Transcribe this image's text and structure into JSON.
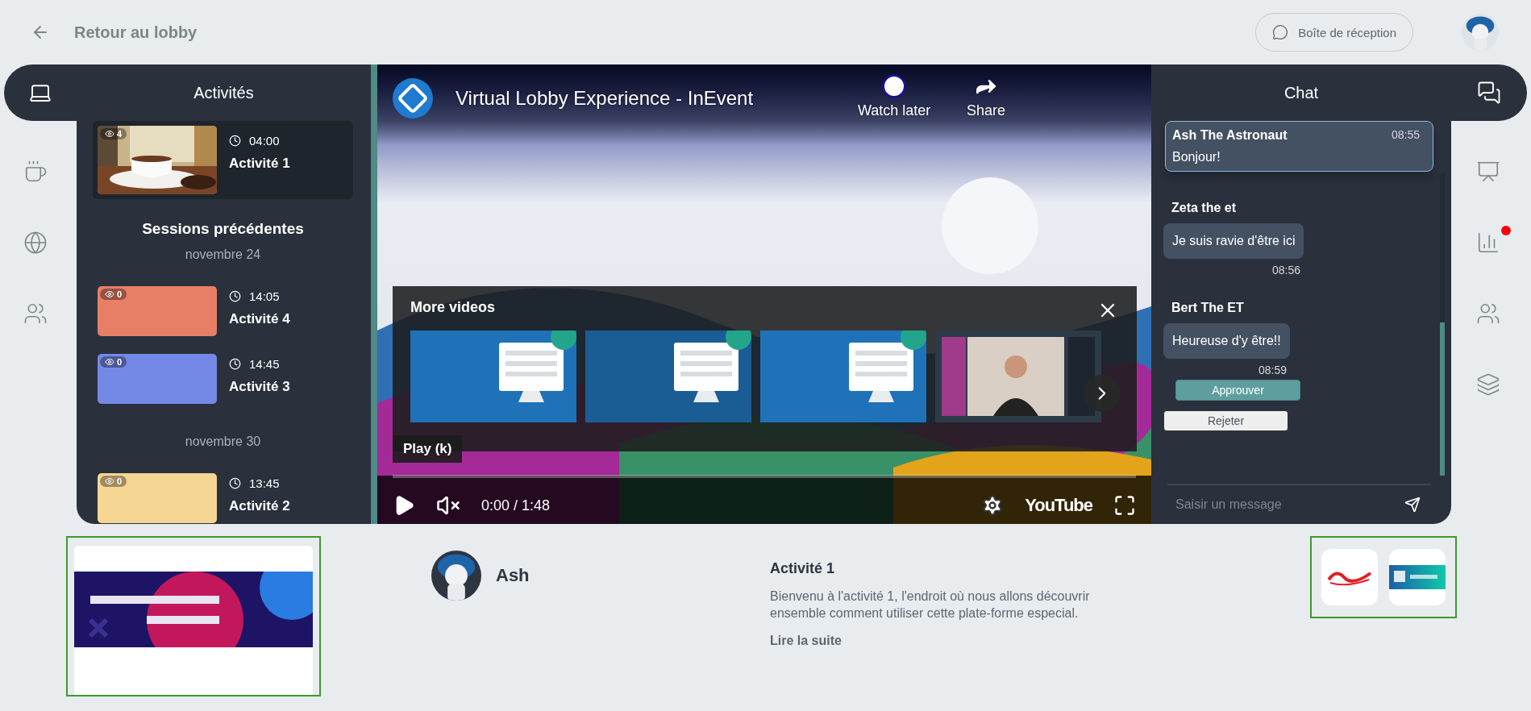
{
  "top_bar": {
    "back_label": "Retour au lobby",
    "inbox_button": "Boîte de réception"
  },
  "left_rail": [
    {
      "kind": "laptop",
      "selected": true
    },
    {
      "kind": "coffee",
      "selected": false
    },
    {
      "kind": "globe",
      "selected": false
    },
    {
      "kind": "people",
      "selected": false
    }
  ],
  "activities": {
    "title": "Activités",
    "current": {
      "views": "4",
      "time": "04:00",
      "name": "Activité 1",
      "kind": "picture",
      "selected": true
    },
    "past_title": "Sessions précédentes",
    "groups": [
      {
        "date": "novembre 24",
        "items": [
          {
            "views": "0",
            "time": "14:05",
            "name": "Activité 4",
            "color": "#e77f67",
            "selected": false
          },
          {
            "views": "0",
            "time": "14:45",
            "name": "Activité 3",
            "color": "#7489e6",
            "selected": false
          }
        ]
      },
      {
        "date": "novembre 30",
        "items": [
          {
            "views": "0",
            "time": "13:45",
            "name": "Activité 2",
            "color": "#f6d693",
            "selected": false
          }
        ]
      }
    ]
  },
  "video": {
    "title": "Virtual Lobby Experience - InEvent",
    "watch_later": "Watch later",
    "share": "Share",
    "more_videos": {
      "title": "More videos"
    },
    "tooltip": "Play (k)",
    "time": "0:00 / 1:48",
    "logo": "YouTube",
    "muted": true
  },
  "chat": {
    "title": "Chat",
    "pinned": {
      "author": "Ash The Astronaut",
      "time": "08:55",
      "text": "Bonjour!"
    },
    "messages": [
      {
        "author": "Zeta the et",
        "text": "Je suis ravie d'être ici",
        "time": "08:56"
      },
      {
        "author": "Bert The ET",
        "text": "Heureuse d'y être!!",
        "time": "08:59",
        "actions": [
          "Approuver",
          "Rejeter"
        ]
      }
    ],
    "input": {
      "placeholder": "Saisir un message"
    }
  },
  "right_rail": [
    {
      "kind": "chat",
      "selected": true,
      "notification": false
    },
    {
      "kind": "presenter",
      "selected": false,
      "notification": false
    },
    {
      "kind": "poll",
      "selected": false,
      "notification": true
    },
    {
      "kind": "people",
      "selected": false,
      "notification": false
    },
    {
      "kind": "layers",
      "selected": false,
      "notification": false
    }
  ],
  "footer": {
    "speaker": {
      "name": "Ash"
    },
    "activity": {
      "title": "Activité 1",
      "description": "Bienvenu à l'activité 1, l'endroit où nous allons découvrir ensemble comment utiliser cette plate-forme especial.",
      "more_link": "Lire la suite"
    }
  }
}
